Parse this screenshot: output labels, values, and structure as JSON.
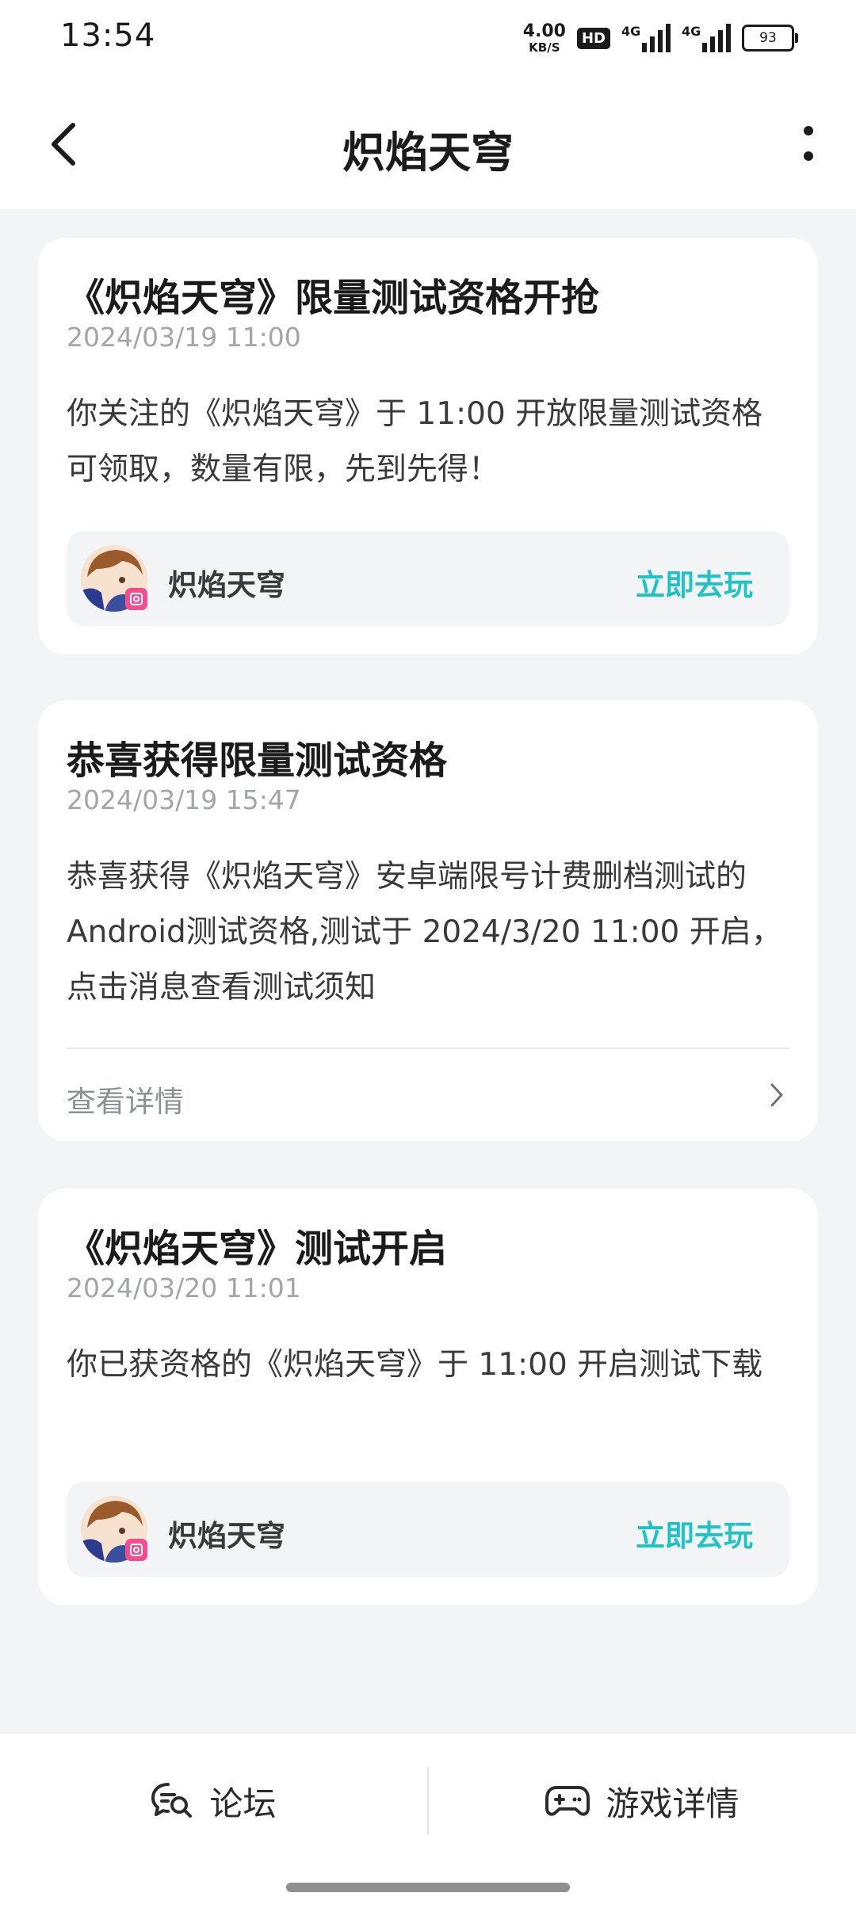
{
  "status_bar": {
    "time": "13:54",
    "net_speed_value": "4.00",
    "net_speed_unit": "KB/S",
    "hd_label": "HD",
    "signal_1_label": "4G",
    "signal_2_label": "4G",
    "battery_level": "93"
  },
  "header": {
    "title": "炽焰天穹",
    "back_icon": "chevron-left-icon",
    "more_icon": "more-vertical-icon"
  },
  "messages": [
    {
      "title": "《炽焰天穹》限量测试资格开抢",
      "time": "2024/03/19 11:00",
      "body": "你关注的《炽焰天穹》于 11:00 开放限量测试资格可领取，数量有限，先到先得！",
      "game_name": "炽焰天穹",
      "action_label": "立即去玩"
    },
    {
      "title": "恭喜获得限量测试资格",
      "time": "2024/03/19 15:47",
      "body": "恭喜获得《炽焰天穹》安卓端限号计费删档测试的Android测试资格,测试于 2024/3/20 11:00 开启，点击消息查看测试须知",
      "detail_label": "查看详情"
    },
    {
      "title": "《炽焰天穹》测试开启",
      "time": "2024/03/20 11:01",
      "body": "你已获资格的《炽焰天穹》于 11:00 开启测试下载",
      "game_name": "炽焰天穹",
      "action_label": "立即去玩"
    }
  ],
  "bottom_bar": {
    "forum_label": "论坛",
    "forum_icon": "chat-search-icon",
    "game_detail_label": "游戏详情",
    "game_detail_icon": "gamepad-icon"
  },
  "colors": {
    "accent": "#1fc3c4",
    "background": "#f3f4f6",
    "card": "#ffffff",
    "muted_text": "#a3a5a8"
  }
}
